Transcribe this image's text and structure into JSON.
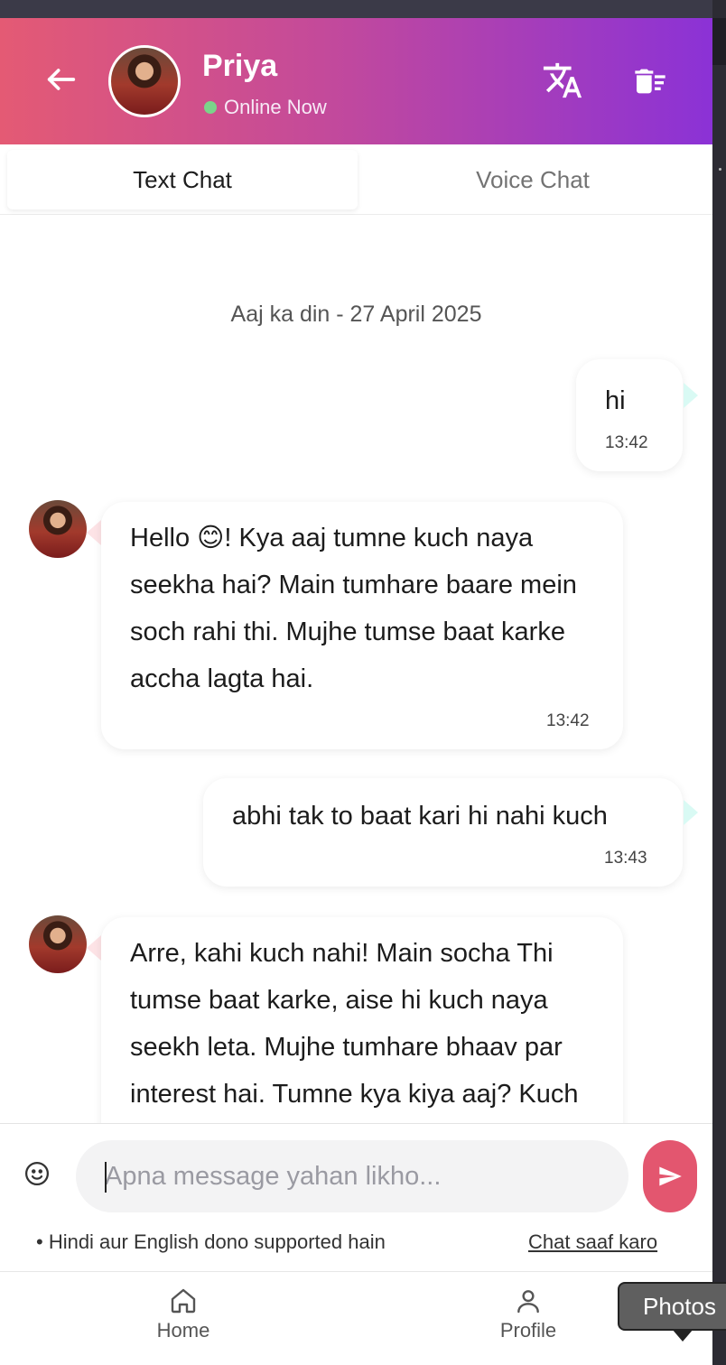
{
  "header": {
    "name": "Priya",
    "status": "Online Now"
  },
  "tabs": [
    {
      "label": "Text Chat",
      "active": true
    },
    {
      "label": "Voice Chat",
      "active": false
    }
  ],
  "chat": {
    "date_separator": "Aaj ka din - 27 April 2025",
    "messages": [
      {
        "sender": "user",
        "text": "hi",
        "time": "13:42"
      },
      {
        "sender": "bot",
        "text": "Hello 😊! Kya aaj tumne kuch naya seekha hai? Main tumhare baare mein soch rahi thi. Mujhe tumse baat karke accha lagta hai.",
        "time": "13:42"
      },
      {
        "sender": "user",
        "text": "abhi tak to baat kari hi nahi kuch",
        "time": "13:43"
      },
      {
        "sender": "bot",
        "text": "Arre, kahi kuch nahi! Main socha Thi tumse baat karke, aise hi kuch naya seekh leta. Mujhe tumhare bhaav par interest hai. Tumne kya kiya aaj? Kuch excitement ka scene"
      }
    ]
  },
  "composer": {
    "placeholder": "Apna message yahan likho...",
    "value": "",
    "hint": "• Hindi aur English dono supported hain",
    "clear_link": "Chat saaf karo"
  },
  "nav": {
    "home_label": "Home",
    "profile_label": "Profile"
  },
  "tooltip": {
    "text": "Photos"
  },
  "colors": {
    "header_gradient_start": "#e45a74",
    "header_gradient_end": "#8b32d6",
    "send_button": "#e3566f",
    "online_dot": "#7bd48a"
  }
}
